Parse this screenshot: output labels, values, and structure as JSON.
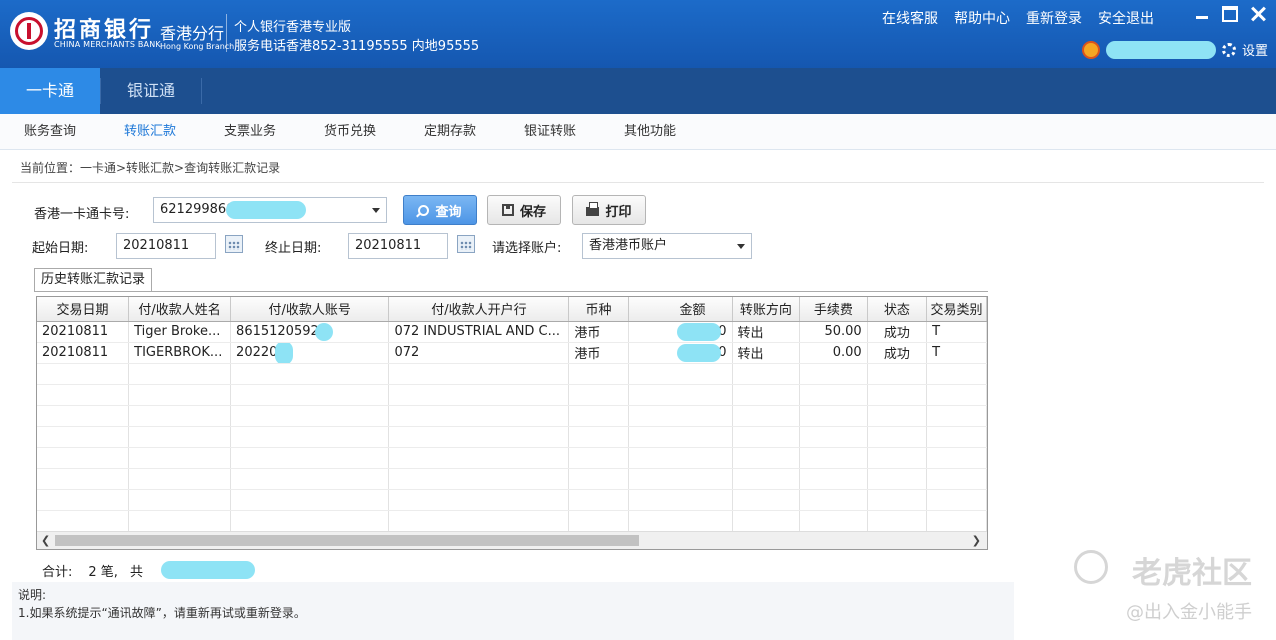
{
  "header": {
    "bank_name_cn": "招商银行",
    "bank_name_en": "CHINA MERCHANTS BANK",
    "branch_cn": "香港分行",
    "branch_en": "Hong Kong Branch",
    "edition": "个人银行香港专业版",
    "hotline": "服务电话香港852-31195555 内地95555",
    "links": [
      "在线客服",
      "帮助中心",
      "重新登录",
      "安全退出"
    ],
    "settings_label": "设置"
  },
  "main_tabs": [
    {
      "label": "一卡通",
      "active": true
    },
    {
      "label": "银证通",
      "active": false
    }
  ],
  "sub_nav": [
    "账务查询",
    "转账汇款",
    "支票业务",
    "货币兑换",
    "定期存款",
    "银证转账",
    "其他功能"
  ],
  "breadcrumb": "当前位置：一卡通>转账汇款>查询转账汇款记录",
  "form": {
    "card_label": "香港一卡通卡号:",
    "card_value": "621299860",
    "query_btn": "查询",
    "save_btn": "保存",
    "print_btn": "打印",
    "start_label": "起始日期:",
    "start_value": "20210811",
    "end_label": "终止日期:",
    "end_value": "20210811",
    "account_label": "请选择账户:",
    "account_value": "香港港币账户"
  },
  "section_tab": "历史转账汇款记录",
  "table": {
    "columns": [
      "交易日期",
      "付/收款人姓名",
      "付/收款人账号",
      "付/收款人开户行",
      "币种",
      "金额",
      "转账方向",
      "手续费",
      "状态",
      "交易类别"
    ],
    "rows": [
      [
        "20210811",
        "Tiger Broke...",
        "8615120592",
        "072 INDUSTRIAL AND C...",
        "港币",
        "0",
        "转出",
        "50.00",
        "成功",
        "T"
      ],
      [
        "20210811",
        "TIGERBROK...",
        "20220",
        "072",
        "港币",
        "0",
        "转出",
        "0.00",
        "成功",
        "T"
      ]
    ]
  },
  "summary": {
    "label": "合计:",
    "count": "2 笔,",
    "total_prefix": "共"
  },
  "notes": {
    "title": "说明:",
    "line1": "1.如果系统提示“通讯故障”，请重新再试或重新登录。"
  },
  "watermark": {
    "brand": "老虎社区",
    "handle": "@出入金小能手"
  }
}
